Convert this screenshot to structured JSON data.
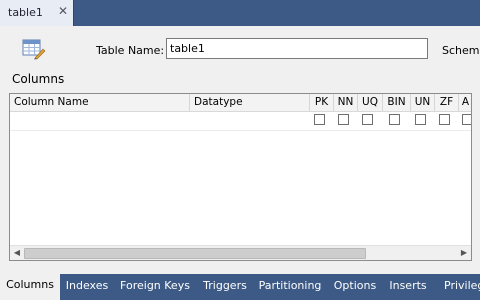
{
  "document_tab": {
    "label": "table1",
    "close_glyph": "✕"
  },
  "header": {
    "table_name_label": "Table Name:",
    "table_name_value": "table1",
    "schema_label": "Schema"
  },
  "columns_section": {
    "title": "Columns",
    "headers": [
      "Column Name",
      "Datatype",
      "PK",
      "NN",
      "UQ",
      "BIN",
      "UN",
      "ZF",
      "A"
    ],
    "new_row_flags": [
      false,
      false,
      false,
      false,
      false,
      false,
      false
    ]
  },
  "scrollbar": {
    "left_glyph": "◀",
    "right_glyph": "▶"
  },
  "bottom_tabs": [
    "Columns",
    "Indexes",
    "Foreign Keys",
    "Triggers",
    "Partitioning",
    "Options",
    "Inserts",
    "Privileg"
  ],
  "active_bottom_tab": "Columns",
  "colors": {
    "tab_bar": "#3c5a85",
    "panel_bg": "#f0f0f0"
  },
  "icons": {
    "table": "table-edit-icon"
  }
}
